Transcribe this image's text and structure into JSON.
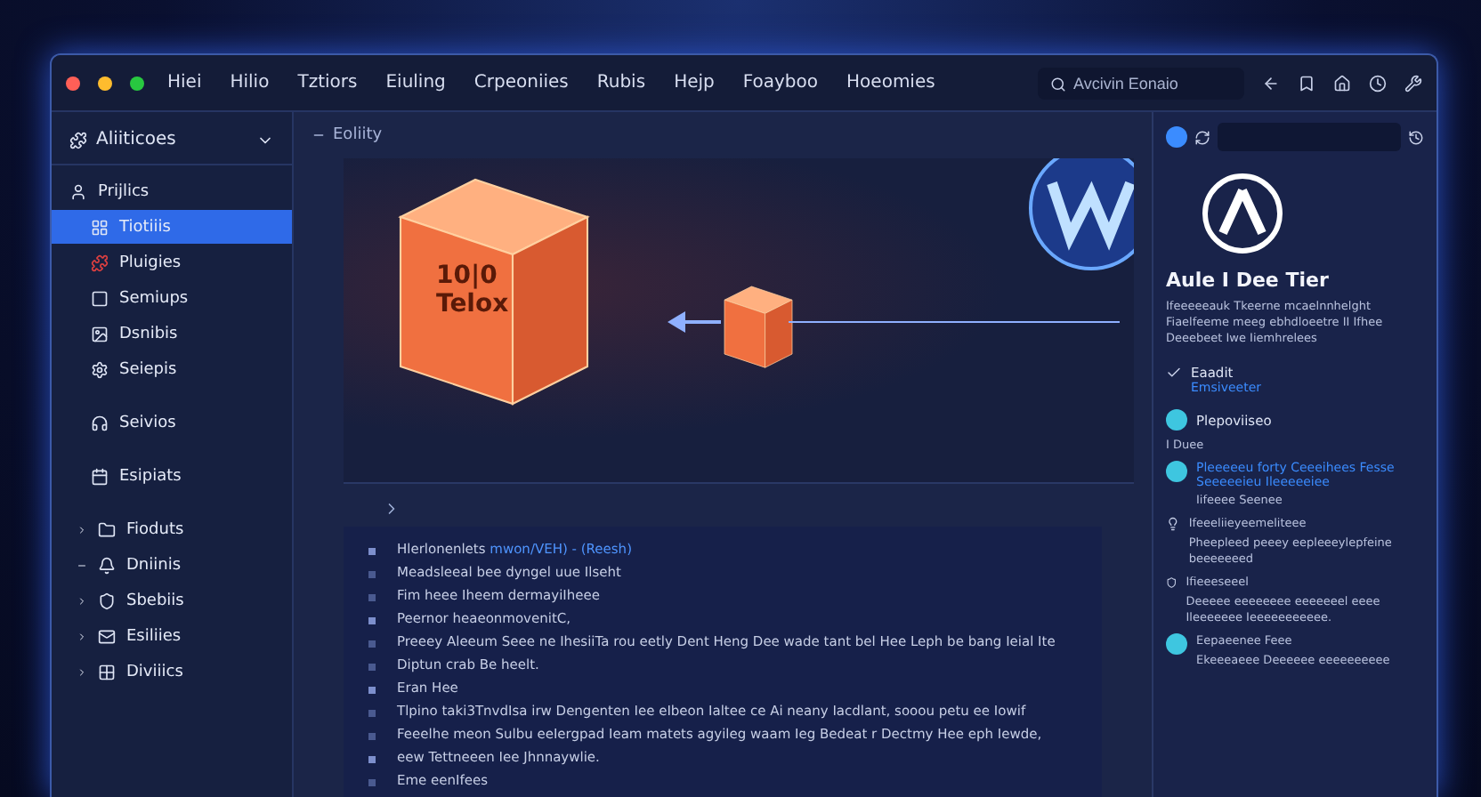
{
  "window": {
    "menu": [
      "Hiei",
      "Hilio",
      "Tztiors",
      "Eiuling",
      "Crpeoniies",
      "Rubis",
      "Hejp",
      "Foayboo",
      "Hoeomies"
    ],
    "search": {
      "placeholder": "Avcivin Eonaio"
    }
  },
  "sidebar": {
    "title": "Aliiticoes",
    "items": [
      {
        "label": "Prijlics",
        "selected": false
      },
      {
        "label": "Tiotiiis",
        "selected": true
      },
      {
        "label": "Pluigies",
        "selected": false
      },
      {
        "label": "Semiups",
        "selected": false
      },
      {
        "label": "Dsnibis",
        "selected": false
      },
      {
        "label": "Seiepis",
        "selected": false
      },
      {
        "label": "Seivios",
        "selected": false
      },
      {
        "label": "Esipiats",
        "selected": false
      },
      {
        "label": "Fioduts",
        "selected": false,
        "expanded": false
      },
      {
        "label": "Dniinis",
        "selected": false,
        "expanded": true
      },
      {
        "label": "Sbebiis",
        "selected": false,
        "expanded": false
      },
      {
        "label": "Esiliies",
        "selected": false,
        "expanded": false
      },
      {
        "label": "Diviiics",
        "selected": false,
        "expanded": false
      }
    ]
  },
  "main": {
    "title": "Eoliity",
    "cube_label": [
      "10|0",
      "Telox"
    ],
    "lines": [
      {
        "text": "Hlerlonenlets",
        "highlight": "mwon/VEH) - (Reesh)"
      },
      {
        "text": "Meadsleeal bee dyngel uue Ilseht"
      },
      {
        "text": "Fim heee Iheem dermayiIheee"
      },
      {
        "text": "Peernor heaeonmovenitC,"
      },
      {
        "text": "Preeey Aleeum Seee ne IhesiiTa rou eetly Dent Heng Dee wade tant bel Hee Leph be bang Ieial Ite"
      },
      {
        "text": "Diptun crab Be heelt."
      },
      {
        "text": "Eran Hee"
      },
      {
        "text": "Tlpino taki3TnvdIsa irw Dengenten Iee eIbeon Ialtee ce Ai neany Iacdlant, sooou petu ee Iowif"
      },
      {
        "text": "Feeelhe meon Sulbu eeIergpad Ieam matets agyileg waam Ieg Bedeat r Dectmy Hee eph Iewde,"
      },
      {
        "text": "eew Tettneeen Iee Jhnnaywlie."
      },
      {
        "text": "Eme eenIfees"
      }
    ]
  },
  "panel": {
    "title": "Aule I Dee Tier",
    "description": "Ifeeeeeauk Tkeerne mcaelnnhelght Fiaelfeeme meeg ebhdloeetre II Ifhee Deeebeet Iwe Iiemhrelees",
    "check": {
      "label": "Eaadit",
      "link": "Emsiveeter",
      "checked": true
    },
    "heading": "Plepoviiseo",
    "sub": "I Duee",
    "entries": [
      {
        "kind": "link",
        "title": "Pleeeeeu forty Ceeeihees Fesse Seeeeeieu Ileeeeeiee",
        "note": "Iifeeee Seenee"
      },
      {
        "kind": "tip",
        "title": "Ifeeeliieyeemeliteee",
        "note": "Pheepleed peeey eepleeeylepfeine beeeeeeed"
      },
      {
        "kind": "shield",
        "title": "Ifieeeseeel",
        "note": "Deeeee eeeeeeee eeeeeeel eeee Ileeeeeee Ieeeeeeeeeee."
      },
      {
        "kind": "avatar",
        "title": "Eepaeenee Feee",
        "note": "Ekeeeaeee Deeeeee eeeeeeeeee"
      }
    ]
  }
}
